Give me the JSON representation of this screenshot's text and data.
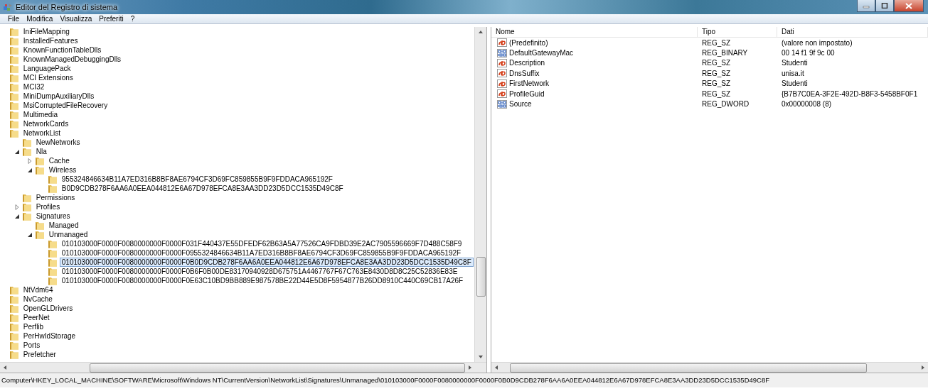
{
  "window": {
    "title": "Editor del Registro di sistema"
  },
  "menu": [
    "File",
    "Modifica",
    "Visualizza",
    "Preferiti",
    "?"
  ],
  "tree": [
    {
      "label": "IniFileMapping",
      "selected": false
    },
    {
      "label": "InstalledFeatures",
      "selected": false
    },
    {
      "label": "KnownFunctionTableDlls",
      "selected": false
    },
    {
      "label": "KnownManagedDebuggingDlls",
      "selected": false
    },
    {
      "label": "LanguagePack",
      "selected": false
    },
    {
      "label": "MCI Extensions",
      "selected": false
    },
    {
      "label": "MCI32",
      "selected": false
    },
    {
      "label": "MiniDumpAuxiliaryDlls",
      "selected": false
    },
    {
      "label": "MsiCorruptedFileRecovery",
      "selected": false
    },
    {
      "label": "Multimedia",
      "selected": false
    },
    {
      "label": "NetworkCards",
      "selected": false
    },
    {
      "label": "NetworkList",
      "selected": false,
      "children": [
        {
          "label": "NewNetworks",
          "selected": false
        },
        {
          "label": "Nla",
          "expanded": true,
          "selected": false,
          "children": [
            {
              "label": "Cache",
              "expanded": false,
              "selected": false
            },
            {
              "label": "Wireless",
              "expanded": true,
              "selected": false,
              "children": [
                {
                  "label": "955324846634B11A7ED316B8BF8AE6794CF3D69FC859855B9F9FDDACA965192F",
                  "selected": false
                },
                {
                  "label": "B0D9CDB278F6AA6A0EEA044812E6A67D978EFCA8E3AA3DD23D5DCC1535D49C8F",
                  "selected": false
                }
              ]
            }
          ]
        },
        {
          "label": "Permissions",
          "selected": false
        },
        {
          "label": "Profiles",
          "expanded": false,
          "selected": false
        },
        {
          "label": "Signatures",
          "expanded": true,
          "selected": false,
          "children": [
            {
              "label": "Managed",
              "selected": false
            },
            {
              "label": "Unmanaged",
              "expanded": true,
              "selected": false,
              "children": [
                {
                  "label": "010103000F0000F0080000000F0000F031F440437E55DFEDF62B63A5A77526CA9FDBD39E2AC7905596669F7D488C58F9",
                  "selected": false
                },
                {
                  "label": "010103000F0000F0080000000F0000F0955324846634B11A7ED316B8BF8AE6794CF3D69FC859855B9F9FDDACA965192F",
                  "selected": false
                },
                {
                  "label": "010103000F0000F0080000000F0000F0B0D9CDB278F6AA6A0EEA044812E6A67D978EFCA8E3AA3DD23D5DCC1535D49C8F",
                  "selected": true
                },
                {
                  "label": "010103000F0000F0080000000F0000F0B6F0B00DE83170940928D675751A4467767F67C763E8430D8D8C25C52836E83E",
                  "selected": false
                },
                {
                  "label": "010103000F0000F0080000000F0000F0E63C10BD9BB889E987578BE22D44E5D8F5954877B26DD8910C440C69CB17A26F",
                  "selected": false
                }
              ]
            }
          ]
        }
      ]
    },
    {
      "label": "NtVdm64",
      "selected": false
    },
    {
      "label": "NvCache",
      "selected": false
    },
    {
      "label": "OpenGLDrivers",
      "selected": false
    },
    {
      "label": "PeerNet",
      "selected": false
    },
    {
      "label": "Perflib",
      "selected": false
    },
    {
      "label": "PerHwIdStorage",
      "selected": false
    },
    {
      "label": "Ports",
      "selected": false
    },
    {
      "label": "Prefetcher",
      "selected": false
    }
  ],
  "values": {
    "columns": [
      "Nome",
      "Tipo",
      "Dati"
    ],
    "rows": [
      {
        "kind": "string",
        "name": "(Predefinito)",
        "type": "REG_SZ",
        "data": "(valore non impostato)"
      },
      {
        "kind": "binary",
        "name": "DefaultGatewayMac",
        "type": "REG_BINARY",
        "data": "00 14 f1 9f 9c 00"
      },
      {
        "kind": "string",
        "name": "Description",
        "type": "REG_SZ",
        "data": "Studenti"
      },
      {
        "kind": "string",
        "name": "DnsSuffix",
        "type": "REG_SZ",
        "data": "unisa.it"
      },
      {
        "kind": "string",
        "name": "FirstNetwork",
        "type": "REG_SZ",
        "data": "Studenti"
      },
      {
        "kind": "string",
        "name": "ProfileGuid",
        "type": "REG_SZ",
        "data": "{B7B7C0EA-3F2E-492D-B8F3-5458BF0F1"
      },
      {
        "kind": "binary",
        "name": "Source",
        "type": "REG_DWORD",
        "data": "0x00000008 (8)"
      }
    ]
  },
  "status_bar": "Computer\\HKEY_LOCAL_MACHINE\\SOFTWARE\\Microsoft\\Windows NT\\CurrentVersion\\NetworkList\\Signatures\\Unmanaged\\010103000F0000F0080000000F0000F0B0D9CDB278F6AA6A0EEA044812E6A67D978EFCA8E3AA3DD23D5DCC1535D49C8F"
}
